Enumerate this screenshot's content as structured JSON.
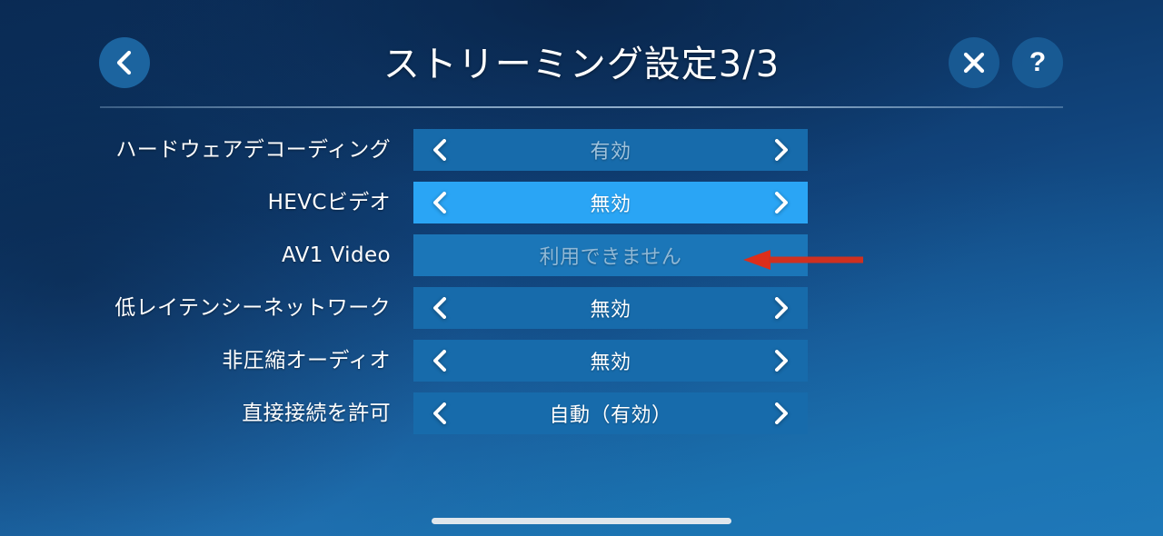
{
  "header": {
    "title": "ストリーミング設定3/3",
    "back_icon": "chevron-left-icon",
    "close_icon": "close-icon",
    "help_label": "?",
    "help_icon": "question-mark-icon"
  },
  "settings": {
    "rows": [
      {
        "label": "ハードウェアデコーディング",
        "value": "有効",
        "state": "normal",
        "value_style": "dim",
        "arrows": true
      },
      {
        "label": "HEVCビデオ",
        "value": "無効",
        "state": "selected",
        "value_style": "bright",
        "arrows": true
      },
      {
        "label": "AV1 Video",
        "value": "利用できません",
        "state": "disabled",
        "value_style": "unavailable",
        "arrows": false
      },
      {
        "label": "低レイテンシーネットワーク",
        "value": "無効",
        "state": "normal",
        "value_style": "bright",
        "arrows": true
      },
      {
        "label": "非圧縮オーディオ",
        "value": "無効",
        "state": "normal",
        "value_style": "bright",
        "arrows": true
      },
      {
        "label": "直接接続を許可",
        "value": "自動（有効）",
        "state": "normal",
        "value_style": "bright",
        "arrows": true
      }
    ],
    "prev_icon": "chevron-left-icon",
    "next_icon": "chevron-right-icon"
  },
  "annotation": {
    "icon": "red-arrow-left-icon",
    "color": "#dd2e1a",
    "points_at": "AV1 Video"
  },
  "system": {
    "home_indicator": "home-indicator-bar"
  },
  "colors": {
    "row_normal": "#176bab",
    "row_selected": "#2aa5f5",
    "row_disabled": "#1b76b8",
    "text_primary": "#ffffff",
    "text_dim": "#9fc2dc",
    "annotation_red": "#dd2e1a",
    "background_dark": "#0a2b55",
    "background_light": "#1a7cb8"
  }
}
